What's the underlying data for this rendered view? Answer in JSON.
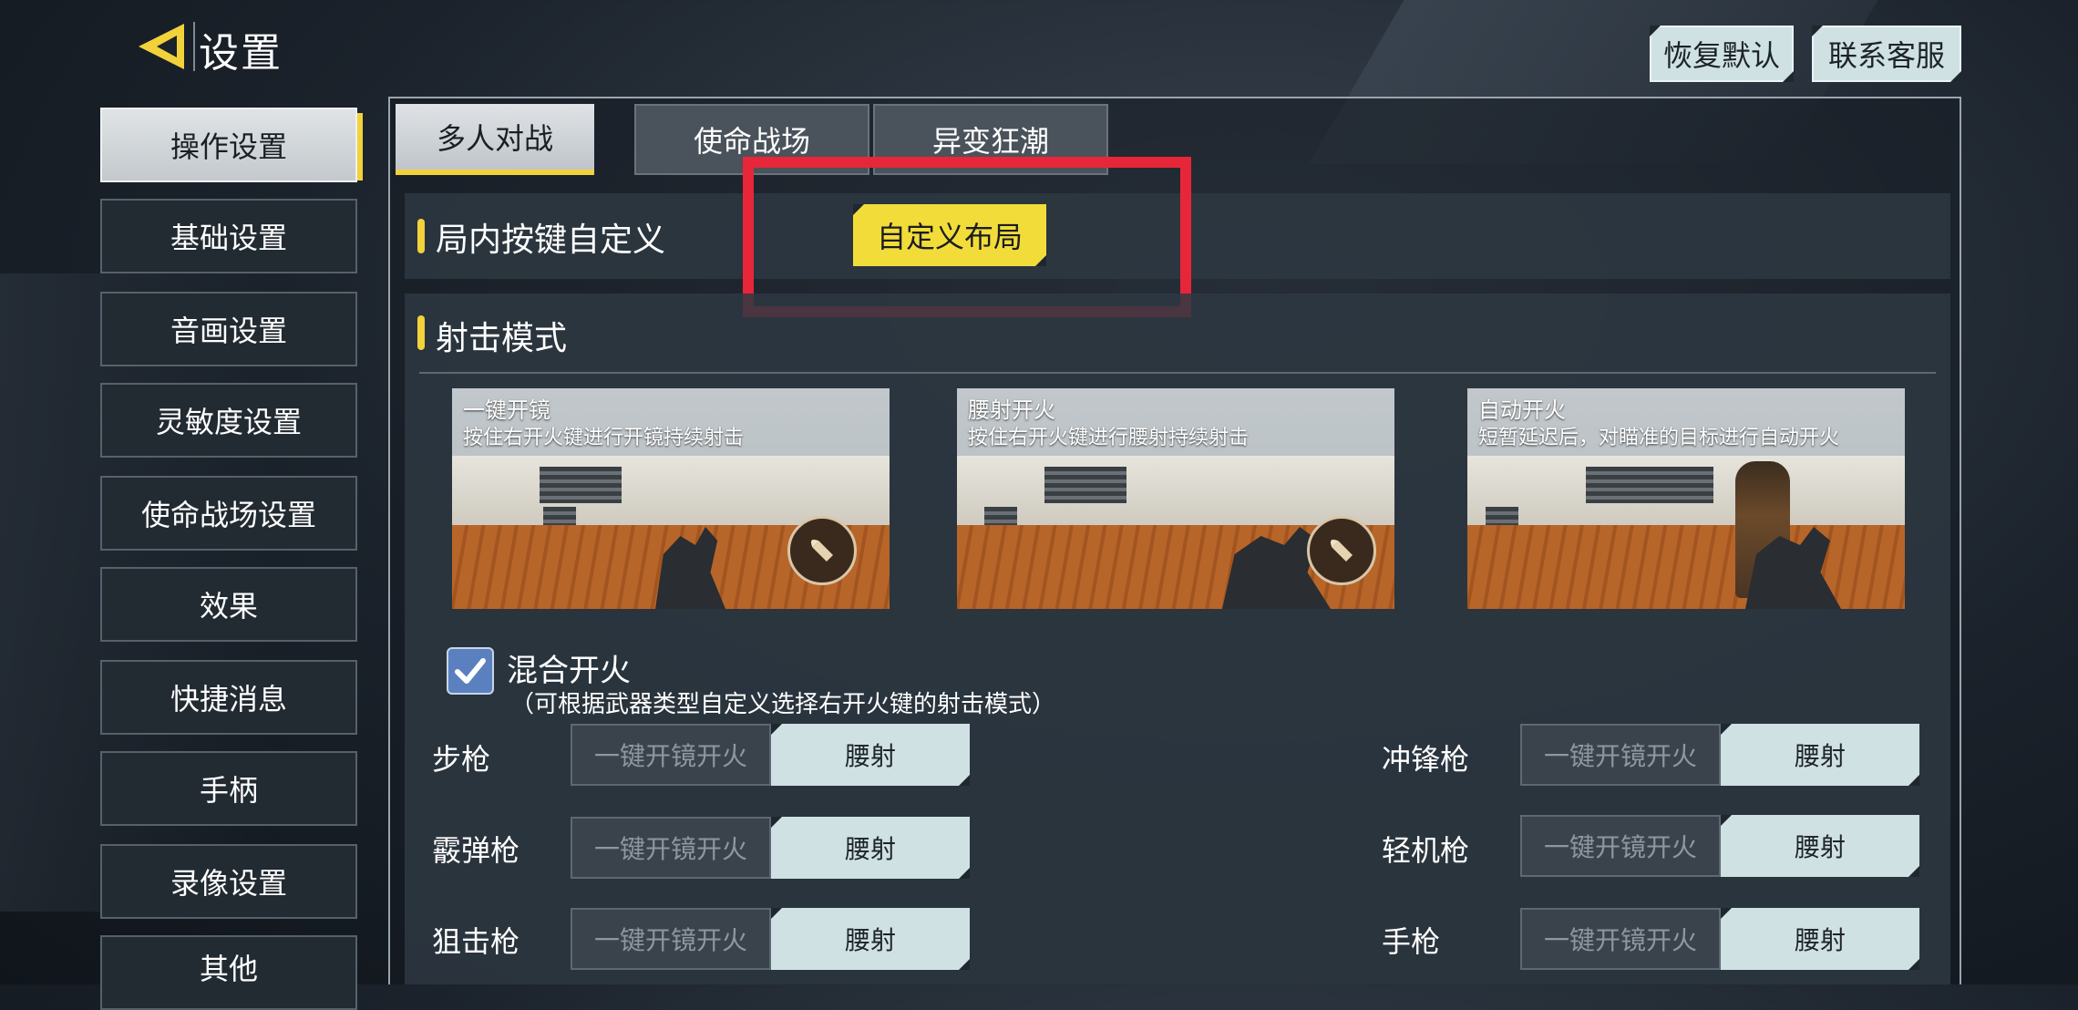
{
  "header": {
    "title": "设置",
    "restore_default_label": "恢复默认",
    "contact_support_label": "联系客服"
  },
  "sidebar": {
    "items": [
      {
        "label": "操作设置",
        "active": true
      },
      {
        "label": "基础设置",
        "active": false
      },
      {
        "label": "音画设置",
        "active": false
      },
      {
        "label": "灵敏度设置",
        "active": false
      },
      {
        "label": "使命战场设置",
        "active": false
      },
      {
        "label": "效果",
        "active": false
      },
      {
        "label": "快捷消息",
        "active": false
      },
      {
        "label": "手柄",
        "active": false
      },
      {
        "label": "录像设置",
        "active": false
      },
      {
        "label": "其他",
        "active": false
      }
    ]
  },
  "tabs": [
    {
      "label": "多人对战",
      "active": true
    },
    {
      "label": "使命战场",
      "active": false
    },
    {
      "label": "异变狂潮",
      "active": false
    }
  ],
  "custom_keys": {
    "title": "局内按键自定义",
    "button_label": "自定义布局"
  },
  "shoot_mode": {
    "title": "射击模式",
    "cards": [
      {
        "title": "一键开镜",
        "desc": "按住右开火键进行开镜持续射击",
        "icon": "bullet-icon"
      },
      {
        "title": "腰射开火",
        "desc": "按住右开火键进行腰射持续射击",
        "icon": "bullet-icon"
      },
      {
        "title": "自动开火",
        "desc": "短暂延迟后，对瞄准的目标进行自动开火",
        "icon": ""
      }
    ]
  },
  "mixed_fire": {
    "label": "混合开火",
    "checked": true,
    "hint": "（可根据武器类型自定义选择右开火键的射击模式）"
  },
  "weapons": [
    {
      "name": "步枪",
      "option_a": "一键开镜开火",
      "option_b": "腰射",
      "selected": "option_b"
    },
    {
      "name": "冲锋枪",
      "option_a": "一键开镜开火",
      "option_b": "腰射",
      "selected": "option_b"
    },
    {
      "name": "霰弹枪",
      "option_a": "一键开镜开火",
      "option_b": "腰射",
      "selected": "option_b"
    },
    {
      "name": "轻机枪",
      "option_a": "一键开镜开火",
      "option_b": "腰射",
      "selected": "option_b"
    },
    {
      "name": "狙击枪",
      "option_a": "一键开镜开火",
      "option_b": "腰射",
      "selected": "option_b"
    },
    {
      "name": "手枪",
      "option_a": "一键开镜开火",
      "option_b": "腰射",
      "selected": "option_b"
    }
  ],
  "colors": {
    "accent_yellow": "#f2d23a",
    "highlight_red": "#e8263a",
    "button_light": "#cfe1e3",
    "checkbox_blue": "#5a80c0"
  }
}
